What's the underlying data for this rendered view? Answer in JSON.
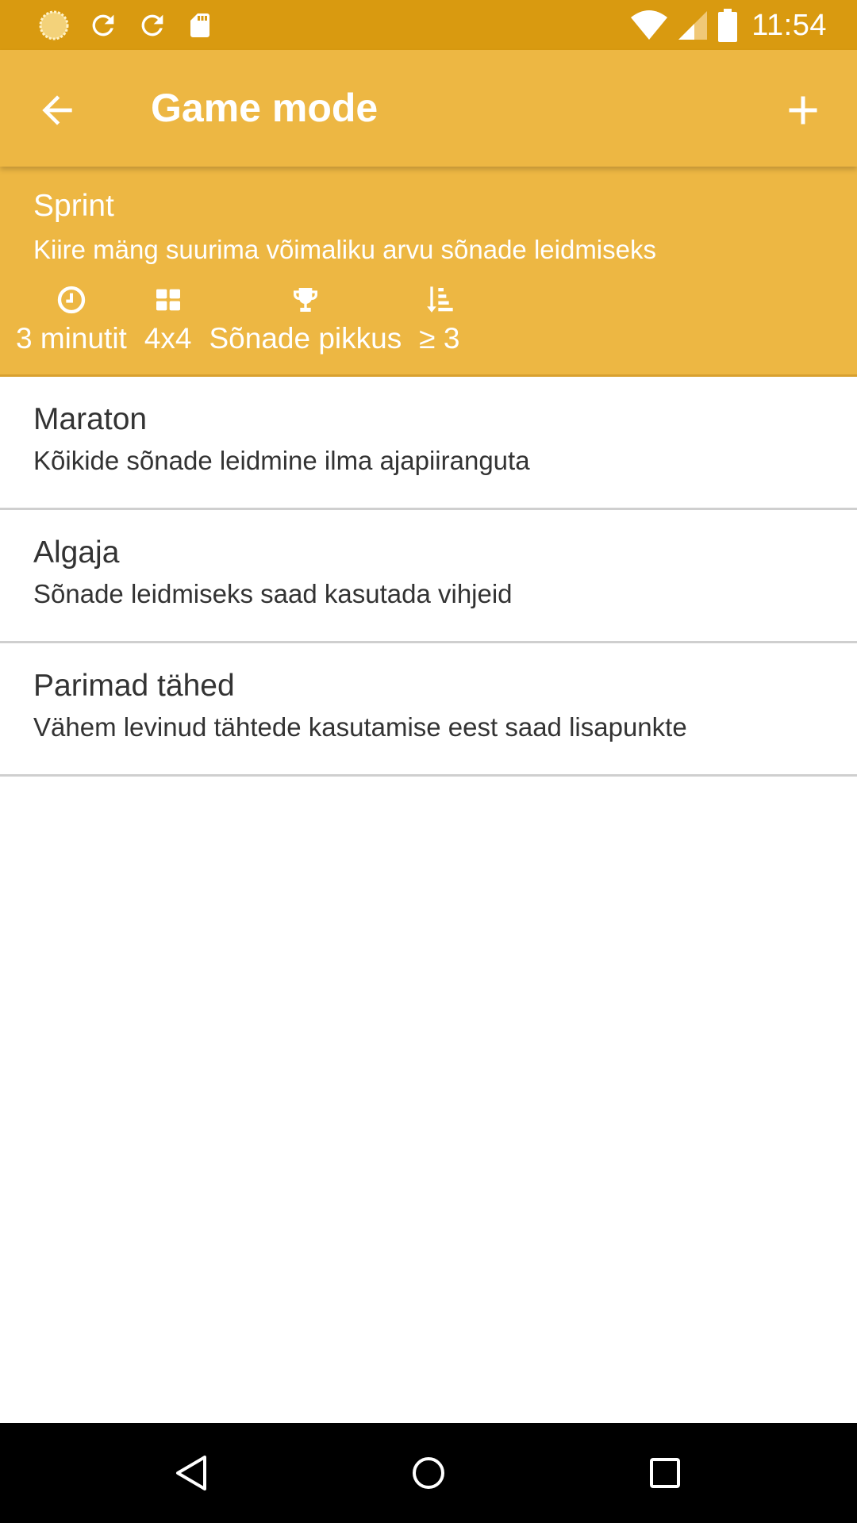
{
  "status_bar": {
    "time": "11:54",
    "icons": [
      "sun-icon",
      "sync-icon",
      "sync-icon",
      "sd-card-icon",
      "wifi-icon",
      "signal-icon",
      "battery-icon"
    ]
  },
  "app_bar": {
    "title": "Game mode",
    "back_icon": "arrow-back-icon",
    "add_icon": "add-icon"
  },
  "modes": [
    {
      "name": "Sprint",
      "description": "Kiire mäng suurima võimaliku arvu sõnade leidmiseks",
      "selected": true,
      "details": [
        {
          "icon": "clock-icon",
          "text": "3 minutit"
        },
        {
          "icon": "grid-icon",
          "text": "4x4"
        },
        {
          "icon": "trophy-icon",
          "text": "Sõnade pikkus"
        },
        {
          "icon": "sort-icon",
          "text": "≥ 3"
        }
      ]
    },
    {
      "name": "Maraton",
      "description": "Kõikide sõnade leidmine ilma ajapiiranguta"
    },
    {
      "name": "Algaja",
      "description": "Sõnade leidmiseks saad kasutada vihjeid"
    },
    {
      "name": "Parimad tähed",
      "description": "Vähem levinud tähtede kasutamise eest saad lisapunkte"
    }
  ],
  "colors": {
    "status_bar": "#d99a10",
    "accent": "#edb743",
    "text": "#333333"
  }
}
